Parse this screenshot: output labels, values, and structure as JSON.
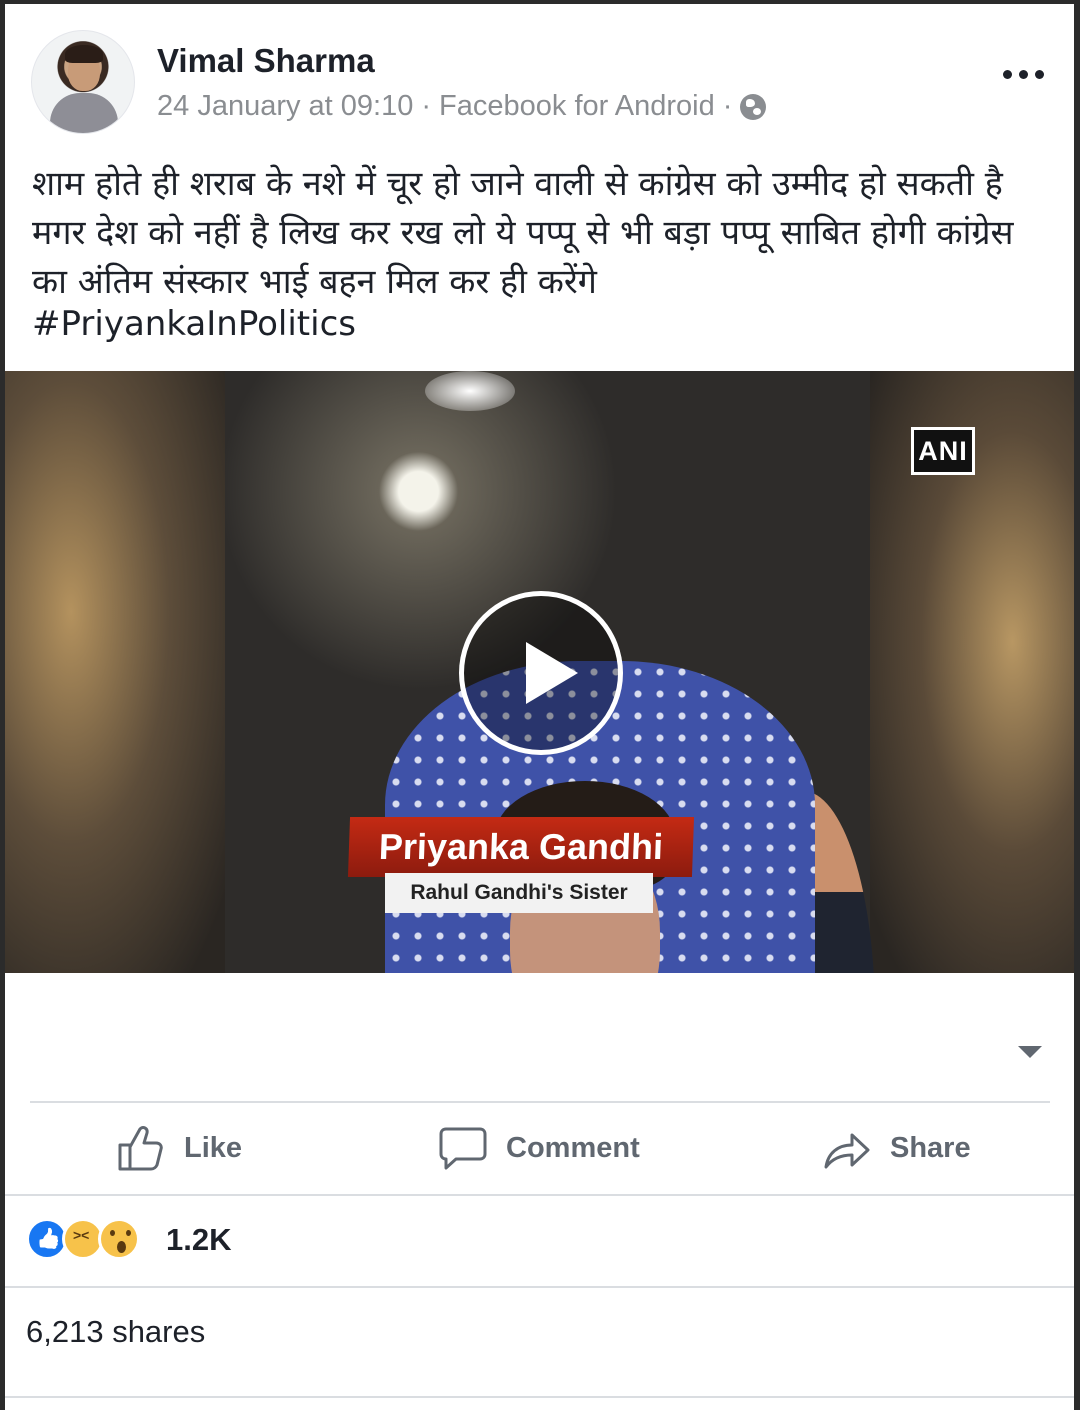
{
  "post": {
    "author": "Vimal Sharma",
    "timestamp": "24 January at 09:10",
    "separator": "·",
    "source": "Facebook for Android",
    "text": "शाम होते ही शराब के नशे में चूर हो जाने वाली से कांग्रेस को उम्मीद हो सकती है मगर देश को नहीं है लिख कर रख लो ये पप्पू से भी बड़ा पप्पू साबित होगी कांग्रेस का अंतिम संस्कार भाई बहन मिल कर ही करेंगे",
    "hashtag": "#PriyankaInPolitics"
  },
  "video": {
    "watermark": "ANI",
    "lower_third_name": "Priyanka Gandhi",
    "lower_third_subtitle": "Rahul Gandhi's Sister"
  },
  "actions": {
    "like_label": "Like",
    "comment_label": "Comment",
    "share_label": "Share"
  },
  "engagement": {
    "reaction_icons": [
      "like-icon",
      "haha-icon",
      "wow-icon"
    ],
    "reaction_count": "1.2K",
    "shares": "6,213 shares"
  },
  "colors": {
    "text_primary": "#1d2129",
    "text_secondary": "#8a8d91",
    "action_gray": "#606770",
    "like_blue": "#1877f2",
    "lower_third_red": "#c42a14"
  }
}
